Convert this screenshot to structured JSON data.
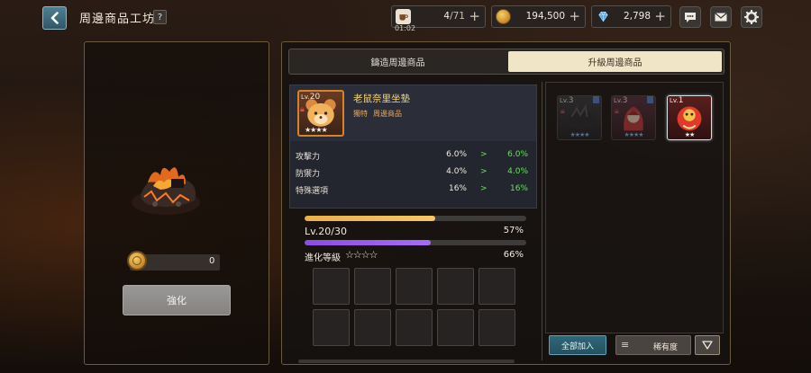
{
  "header": {
    "title": "周邊商品工坊",
    "help_label": "?"
  },
  "resources": {
    "stamina": {
      "icon": "coffee-cup-icon",
      "value": "4",
      "max": "/71",
      "timer": "01:02"
    },
    "gold": {
      "icon": "gold-coin-icon",
      "value": "194,500"
    },
    "gems": {
      "icon": "diamond-icon",
      "value": "2,798"
    }
  },
  "left_panel": {
    "cost_value": "0",
    "enhance_label": "強化"
  },
  "tabs": [
    {
      "label": "鑄造周邊商品",
      "active": false
    },
    {
      "label": "升級周邊商品",
      "active": true
    }
  ],
  "item": {
    "level_prefix": "Lv.",
    "level": "20",
    "stars": "★★★★",
    "name": "老鼠奈里坐墊",
    "tag_1": "獨特",
    "tag_2": "周邊商品"
  },
  "stats": [
    {
      "label": "攻擊力",
      "current": "6.0%",
      "arrow": ">",
      "next": "6.0%"
    },
    {
      "label": "防禦力",
      "current": "4.0%",
      "arrow": ">",
      "next": "4.0%"
    },
    {
      "label": "特殊選項",
      "current": "16%",
      "arrow": ">",
      "next": "16%"
    }
  ],
  "progress": {
    "gold_bar_fraction": 0.59,
    "level_label": "Lv.20/30",
    "level_percent": "57%",
    "level_fraction": 0.57,
    "evolution_label": "進化等級",
    "evolution_stars": "☆☆☆☆",
    "evolution_percent": "66%"
  },
  "inventory": [
    {
      "level_prefix": "Lv.",
      "level": "3",
      "stars": "★★★★",
      "locked": true,
      "selected": false
    },
    {
      "level_prefix": "Lv.",
      "level": "3",
      "stars": "★★★★",
      "locked": true,
      "selected": false
    },
    {
      "level_prefix": "Lv.",
      "level": "1",
      "stars": "★★",
      "locked": false,
      "selected": true
    }
  ],
  "buttons": {
    "add_all_label": "全部加入",
    "sort_label": "稀有度"
  },
  "colors": {
    "accent_gold": "#f6d56e",
    "stat_green": "#66e25c",
    "tab_active_bg": "#f1e5c8",
    "progress_purple": "#a56df5",
    "progress_gold": "#f4c866"
  }
}
